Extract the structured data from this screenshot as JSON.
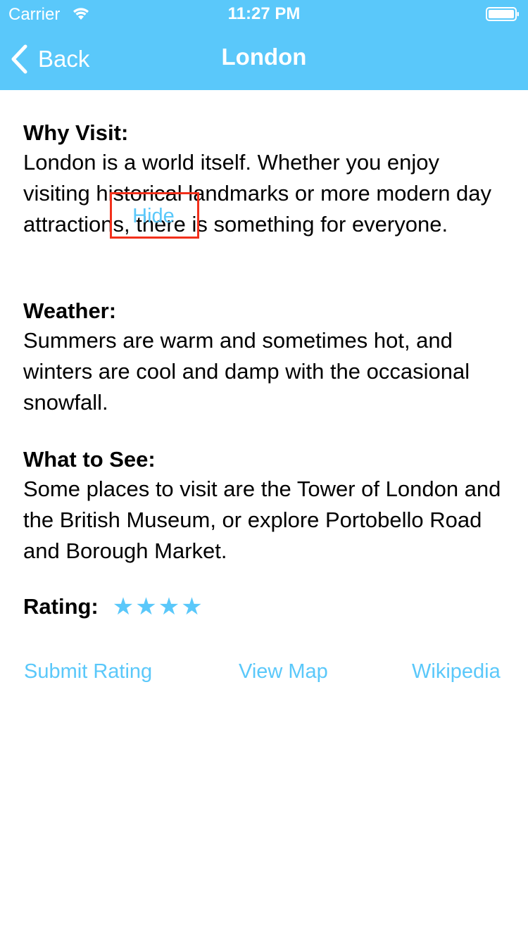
{
  "status_bar": {
    "carrier": "Carrier",
    "time": "11:27 PM",
    "wifi_icon": "wifi-icon",
    "battery_icon": "battery-full-icon"
  },
  "nav": {
    "back_label": "Back",
    "back_icon": "chevron-left-icon",
    "title": "London",
    "bar_color": "#5ac8fa"
  },
  "sections": [
    {
      "heading": "Why Visit:",
      "text": "London is a world itself. Whether you enjoy visiting historical landmarks or more modern day attractions, there is something for everyone."
    },
    {
      "heading": "Weather:",
      "text": "Summers are warm and sometimes hot, and winters are cool and damp with the occasional snowfall."
    },
    {
      "heading": "What to See:",
      "text": "Some places to visit are the Tower of London and the British Museum, or explore Portobello Road and Borough Market."
    }
  ],
  "rating": {
    "label": "Rating:",
    "stars_display": "★★★★",
    "value": 4
  },
  "actions": {
    "submit_rating": "Submit Rating",
    "view_map": "View Map",
    "wikipedia": "Wikipedia"
  },
  "overlay": {
    "hide_label": "Hide",
    "highlight_color": "#f2301b"
  },
  "colors": {
    "accent": "#5ac8fa",
    "text": "#000000",
    "background": "#ffffff"
  }
}
